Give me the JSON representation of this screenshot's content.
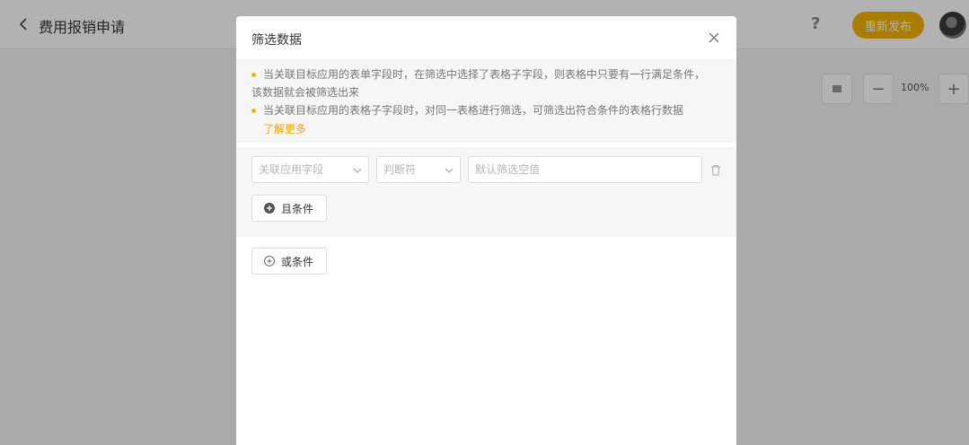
{
  "app": {
    "title": "费用报销申请",
    "publish_label": "重新发布",
    "help_label": "?",
    "zoom_level": "100%",
    "zoom_out_label": "−",
    "zoom_in_label": "+"
  },
  "modal": {
    "title": "筛选数据",
    "tips": [
      {
        "line1": "当关联目标应用的表单字段时，在筛选中选择了表格子字段，则表格中只要有一行满足条件，",
        "line2": "该数据就会被筛选出来"
      },
      {
        "line1": "当关联目标应用的表格子字段时，对同一表格进行筛选，可筛选出符合条件的表格行数据",
        "line2": ""
      }
    ],
    "learn_more": "了解更多",
    "condition": {
      "field_placeholder": "关联应用字段",
      "operator_placeholder": "判断符",
      "value_placeholder": "默认筛选空值",
      "value": ""
    },
    "and_label": "且条件",
    "or_label": "或条件"
  },
  "colors": {
    "accent": "#f4b400",
    "link": "#f0a500",
    "tip_bg": "#f5f6f5"
  }
}
